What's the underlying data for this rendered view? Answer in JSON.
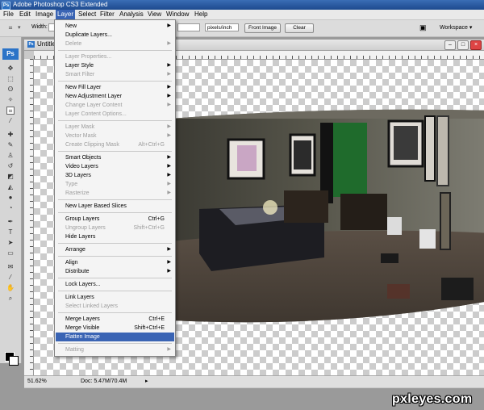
{
  "app": {
    "title": "Adobe Photoshop CS3 Extended",
    "logo": "Ps"
  },
  "menubar": [
    "File",
    "Edit",
    "Image",
    "Layer",
    "Select",
    "Filter",
    "Analysis",
    "View",
    "Window",
    "Help"
  ],
  "options": {
    "width_label": "Width:",
    "resolution_unit": "pixels/inch",
    "front_image_label": "Front Image",
    "clear_label": "Clear",
    "workspace_label": "Workspace"
  },
  "document": {
    "title": "Untitle",
    "zoom": "51.62%",
    "doc_info": "Doc: 5.47M/70.4M"
  },
  "layer_menu": [
    {
      "label": "New",
      "submenu": true
    },
    {
      "label": "Duplicate Layers..."
    },
    {
      "label": "Delete",
      "submenu": true,
      "disabled": true
    },
    {
      "separator": true
    },
    {
      "label": "Layer Properties...",
      "disabled": true
    },
    {
      "label": "Layer Style",
      "submenu": true
    },
    {
      "label": "Smart Filter",
      "submenu": true,
      "disabled": true
    },
    {
      "separator": true
    },
    {
      "label": "New Fill Layer",
      "submenu": true
    },
    {
      "label": "New Adjustment Layer",
      "submenu": true
    },
    {
      "label": "Change Layer Content",
      "submenu": true,
      "disabled": true
    },
    {
      "label": "Layer Content Options...",
      "disabled": true
    },
    {
      "separator": true
    },
    {
      "label": "Layer Mask",
      "submenu": true,
      "disabled": true
    },
    {
      "label": "Vector Mask",
      "submenu": true,
      "disabled": true
    },
    {
      "label": "Create Clipping Mask",
      "shortcut": "Alt+Ctrl+G",
      "disabled": true
    },
    {
      "separator": true
    },
    {
      "label": "Smart Objects",
      "submenu": true
    },
    {
      "label": "Video Layers",
      "submenu": true
    },
    {
      "label": "3D Layers",
      "submenu": true
    },
    {
      "label": "Type",
      "submenu": true,
      "disabled": true
    },
    {
      "label": "Rasterize",
      "submenu": true,
      "disabled": true
    },
    {
      "separator": true
    },
    {
      "label": "New Layer Based Slices"
    },
    {
      "separator": true
    },
    {
      "label": "Group Layers",
      "shortcut": "Ctrl+G"
    },
    {
      "label": "Ungroup Layers",
      "shortcut": "Shift+Ctrl+G",
      "disabled": true
    },
    {
      "label": "Hide Layers"
    },
    {
      "separator": true
    },
    {
      "label": "Arrange",
      "submenu": true
    },
    {
      "separator": true
    },
    {
      "label": "Align",
      "submenu": true
    },
    {
      "label": "Distribute",
      "submenu": true
    },
    {
      "separator": true
    },
    {
      "label": "Lock Layers..."
    },
    {
      "separator": true
    },
    {
      "label": "Link Layers"
    },
    {
      "label": "Select Linked Layers",
      "disabled": true
    },
    {
      "separator": true
    },
    {
      "label": "Merge Layers",
      "shortcut": "Ctrl+E"
    },
    {
      "label": "Merge Visible",
      "shortcut": "Shift+Ctrl+E"
    },
    {
      "label": "Flatten Image",
      "highlighted": true
    },
    {
      "separator": true
    },
    {
      "label": "Matting",
      "submenu": true,
      "disabled": true
    }
  ],
  "watermark": "pxleyes.com"
}
